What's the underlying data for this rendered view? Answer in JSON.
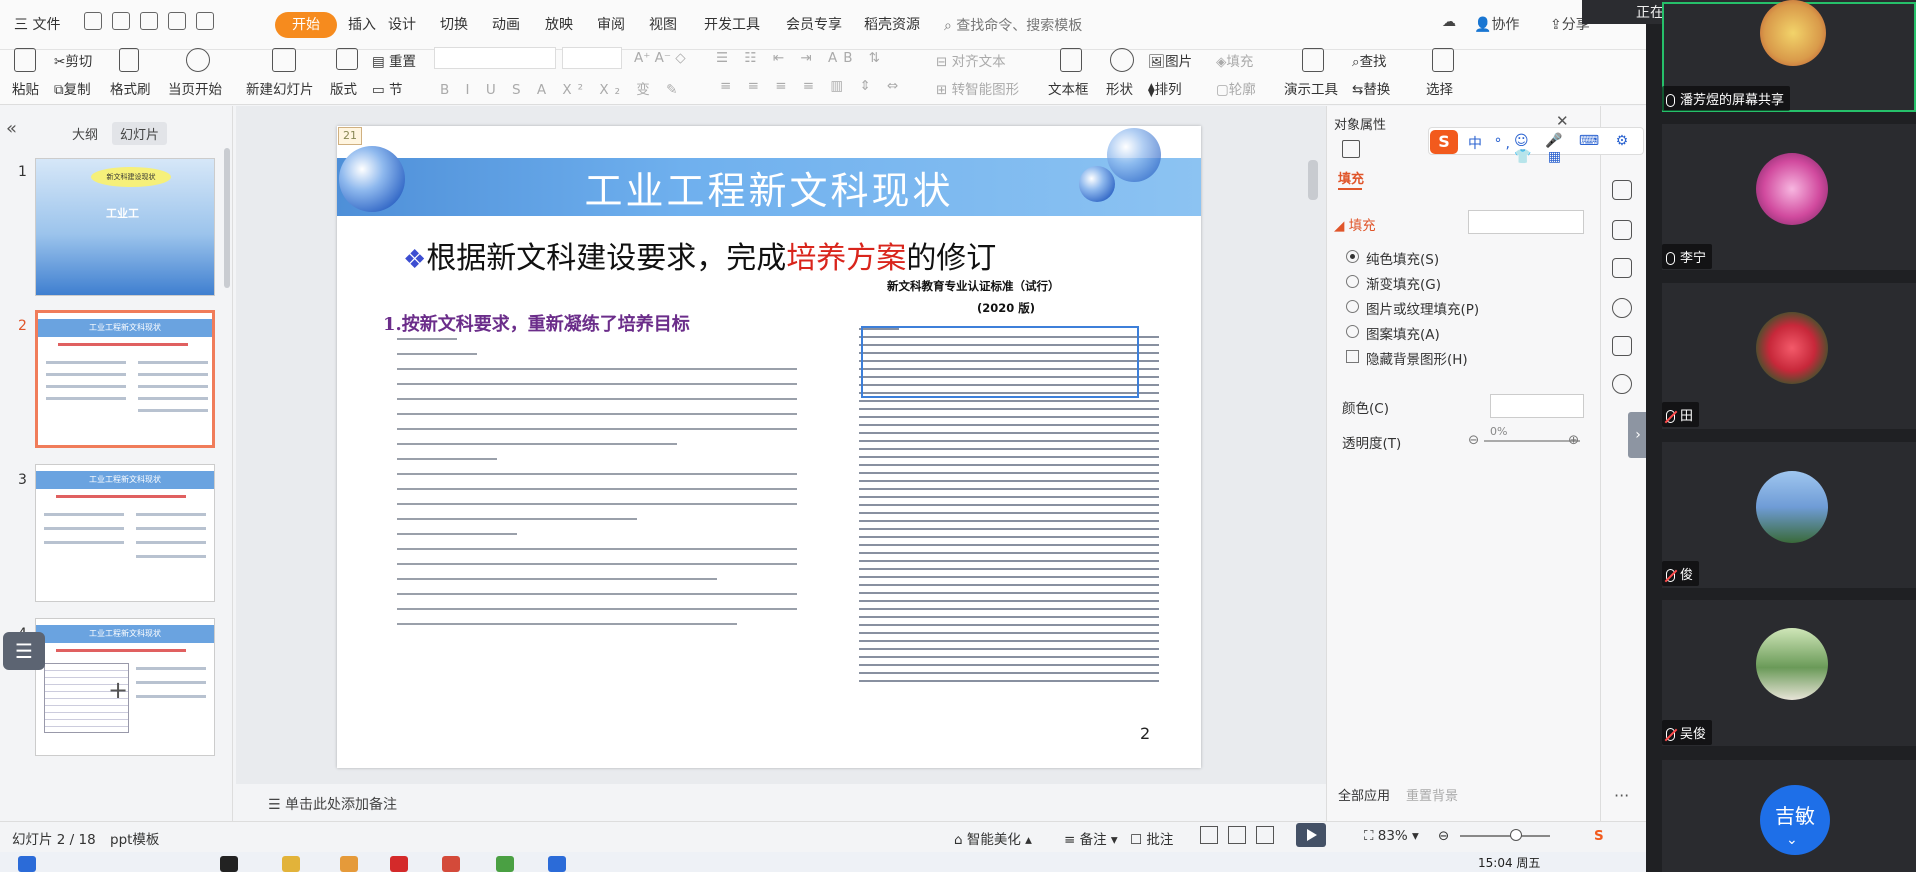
{
  "menubar": {
    "file": "三 文件",
    "tabs": [
      "开始",
      "插入",
      "设计",
      "切换",
      "动画",
      "放映",
      "审阅",
      "视图",
      "开发工具",
      "会员专享",
      "稻壳资源"
    ],
    "search": "查找命令、搜索模板",
    "collab": "协作",
    "share": "分享"
  },
  "ribbon": {
    "paste": "粘贴",
    "cut": "剪切",
    "copy": "复制",
    "format_painter": "格式刷",
    "play_from_current": "当页开始",
    "new_slide": "新建幻灯片",
    "layout": "版式",
    "section": "节",
    "reset": "重置",
    "align_text": "对齐文本",
    "convert_smartart": "转智能图形",
    "textbox": "文本框",
    "shape": "形状",
    "arrange": "排列",
    "picture": "图片",
    "fill": "填充",
    "outline": "轮廓",
    "presentation_tools": "演示工具",
    "find": "查找",
    "replace": "替换",
    "select": "选择"
  },
  "left_panel": {
    "tab_outline": "大纲",
    "tab_slides": "幻灯片",
    "thumbnails": [
      {
        "num": "1",
        "title": "工业工",
        "subtitle": "新文科建设现状"
      },
      {
        "num": "2",
        "title": "工业工程新文科现状"
      },
      {
        "num": "3",
        "title": "工业工程新文科现状"
      },
      {
        "num": "4",
        "title": "工业工程新文科现状"
      }
    ],
    "add_label": "+"
  },
  "slide": {
    "tag": "21",
    "title": "工业工程新文科现状",
    "heading_prefix": "根据新文科建设要求，完成",
    "heading_red": "培养方案",
    "heading_suffix": "的修订",
    "subheading": "1.按新文科要求，重新凝练了培养目标",
    "standard_title": "新文科教育专业认证标准（试行）",
    "standard_year": "(2020 版)",
    "page_number": "2"
  },
  "notes": {
    "placeholder": "单击此处添加备注"
  },
  "right_pane": {
    "title": "对象属性",
    "tab_fill": "填充",
    "section_fill": "填充",
    "options": [
      {
        "label": "纯色填充(S)",
        "checked": true
      },
      {
        "label": "渐变填充(G)",
        "checked": false
      },
      {
        "label": "图片或纹理填充(P)",
        "checked": false
      },
      {
        "label": "图案填充(A)",
        "checked": false
      }
    ],
    "hide_bg": "隐藏背景图形(H)",
    "color_label": "颜色(C)",
    "transparency_label": "透明度(T)",
    "transparency_value": "0%",
    "apply_all": "全部应用",
    "reset_bg": "重置背景"
  },
  "ime": {
    "logo": "S",
    "text": "中 °,"
  },
  "statusbar": {
    "slide_info": "幻灯片 2 / 18",
    "template": "ppt模板",
    "beautify": "智能美化",
    "notes": "备注",
    "comment": "批注",
    "zoom": "83%"
  },
  "taskbar": {
    "time": "15:04 周五"
  },
  "conference": {
    "speaking": "正在讲话: 潘芳煜;",
    "participants": [
      {
        "name": "潘芳煜的屏幕共享",
        "avatar_color": "#d99a4a",
        "muted": false,
        "active": true
      },
      {
        "name": "李宁",
        "avatar_color": "#d14a9e",
        "muted": false,
        "active": false
      },
      {
        "name": "田",
        "avatar_color": "#c7283a",
        "muted": true,
        "active": false
      },
      {
        "name": "俊",
        "avatar_color": "#6f9cd6",
        "muted": true,
        "active": false
      },
      {
        "name": "吴俊",
        "avatar_color": "#6a9a58",
        "muted": true,
        "active": false
      }
    ],
    "bubble": "吉敏"
  }
}
